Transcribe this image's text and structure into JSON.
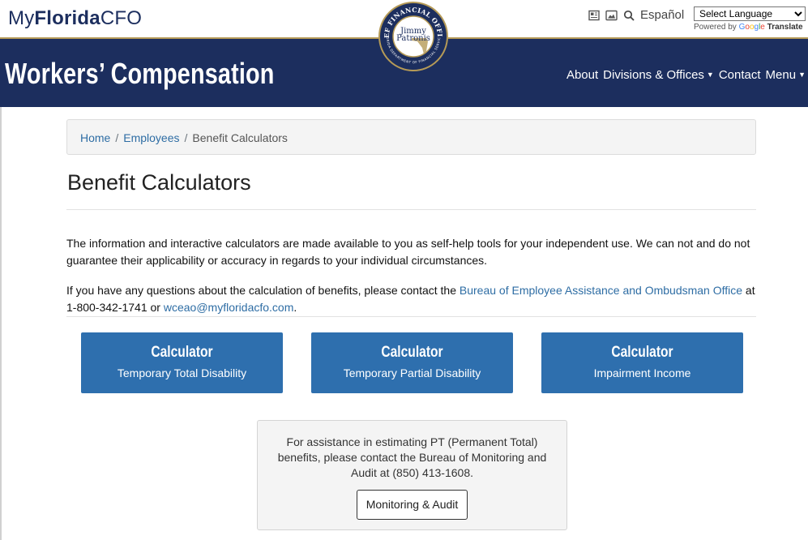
{
  "header": {
    "brand_prefix": "My",
    "brand_bold": "Florida",
    "brand_suffix": "CFO",
    "espanol": "Español",
    "language_select": "Select Language",
    "powered_by": "Powered by",
    "google": [
      "G",
      "o",
      "o",
      "g",
      "l",
      "e"
    ],
    "translate": "Translate",
    "seal": {
      "top_text": "CHIEF FINANCIAL OFFICER",
      "name_line1": "Jimmy",
      "name_line2": "Patronis",
      "bottom_text": "FLORIDA DEPARTMENT OF FINANCIAL SERVICES"
    }
  },
  "navbar": {
    "section_title": "Workers’ Compensation",
    "items": [
      "About",
      "Divisions & Offices",
      "Contact",
      "Menu"
    ]
  },
  "breadcrumb": {
    "home": "Home",
    "employees": "Employees",
    "current": "Benefit Calculators",
    "sep": "/"
  },
  "page": {
    "title": "Benefit Calculators",
    "intro": "The information and interactive calculators are made available to you as self-help tools for your independent use. We can not and do not guarantee their applicability or accuracy in regards to your individual circumstances.",
    "contact_pre": "If you have any questions about the calculation of benefits, please contact the ",
    "contact_link": "Bureau of Employee Assistance and Ombudsman Office",
    "contact_mid": " at 1-800-342-1741 or ",
    "contact_email": "wceao@myfloridacfo.com",
    "contact_end": "."
  },
  "calculators": [
    {
      "title": "Calculator",
      "subtitle": "Temporary Total Disability"
    },
    {
      "title": "Calculator",
      "subtitle": "Temporary Partial Disability"
    },
    {
      "title": "Calculator",
      "subtitle": "Impairment Income"
    }
  ],
  "assistance": {
    "text": "For assistance in estimating PT (Permanent Total) benefits, please contact the Bureau of Monitoring and Audit at (850) 413-1608.",
    "button": "Monitoring & Audit"
  },
  "colors": {
    "navy": "#1c2e5e",
    "gold": "#b59a57",
    "button_blue": "#2e6fae",
    "link": "#2e6da4"
  }
}
